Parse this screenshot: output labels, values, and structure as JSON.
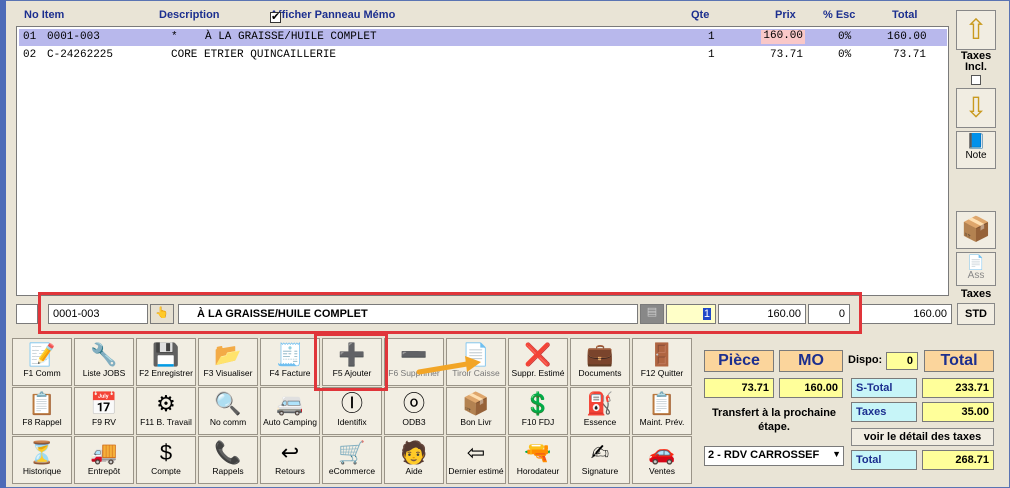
{
  "header": {
    "col_no_item": "No Item",
    "col_description": "Description",
    "memo_label": "Afficher Panneau Mémo",
    "col_qte": "Qte",
    "col_prix": "Prix",
    "col_esc": "% Esc",
    "col_total": "Total"
  },
  "rows": [
    {
      "no": "01",
      "item": "0001-003",
      "flag": "*",
      "desc": "À LA GRAISSE/HUILE COMPLET",
      "qte": "1",
      "prix": "160.00",
      "esc": "0%",
      "total": "160.00"
    },
    {
      "no": "02",
      "item": "C-24262225",
      "flag": "",
      "desc": "CORE ETRIER QUINCAILLERIE",
      "qte": "1",
      "prix": "73.71",
      "esc": "0%",
      "total": "73.71"
    }
  ],
  "right": {
    "taxes_incl": "Taxes Incl.",
    "note": "Note",
    "ass": "Ass",
    "taxes": "Taxes",
    "std": "STD"
  },
  "edit": {
    "item": "0001-003",
    "desc": "À LA GRAISSE/HUILE COMPLET",
    "qte": "1",
    "prix": "160.00",
    "esc": "0",
    "total": "160.00"
  },
  "toolbar": [
    {
      "label": "F1 Comm",
      "icon": "📝"
    },
    {
      "label": "Liste JOBS",
      "icon": "🔧"
    },
    {
      "label": "F2 Enregistrer",
      "icon": "💾"
    },
    {
      "label": "F3 Visualiser",
      "icon": "📂"
    },
    {
      "label": "F4 Facture",
      "icon": "🧾"
    },
    {
      "label": "F5 Ajouter",
      "icon": "➕"
    },
    {
      "label": "F6 Supprimer",
      "icon": "➖"
    },
    {
      "label": "Tiroir Caisse",
      "icon": "📄"
    },
    {
      "label": "Suppr. Estimé",
      "icon": "❌"
    },
    {
      "label": "Documents",
      "icon": "💼"
    },
    {
      "label": "F12 Quitter",
      "icon": "🚪"
    },
    {
      "label": "F8 Rappel",
      "icon": "📋"
    },
    {
      "label": "F9 RV",
      "icon": "📅"
    },
    {
      "label": "F11 B. Travail",
      "icon": "⚙"
    },
    {
      "label": "No comm",
      "icon": "🔍"
    },
    {
      "label": "Auto Camping",
      "icon": "🚐"
    },
    {
      "label": "Identifix",
      "icon": "Ⓘ"
    },
    {
      "label": "ODB3",
      "icon": "ⓞ"
    },
    {
      "label": "Bon Livr",
      "icon": "📦"
    },
    {
      "label": "F10 FDJ",
      "icon": "💲"
    },
    {
      "label": "Essence",
      "icon": "⛽"
    },
    {
      "label": "Maint. Prév.",
      "icon": "📋"
    },
    {
      "label": "Historique",
      "icon": "⏳"
    },
    {
      "label": "Entrepôt",
      "icon": "🚚"
    },
    {
      "label": "Compte",
      "icon": "$"
    },
    {
      "label": "Rappels",
      "icon": "📞"
    },
    {
      "label": "Retours",
      "icon": "↩"
    },
    {
      "label": "eCommerce",
      "icon": "🛒"
    },
    {
      "label": "Aide",
      "icon": "🧑"
    },
    {
      "label": "Dernier estimé",
      "icon": "⇦"
    },
    {
      "label": "Horodateur",
      "icon": "🔫"
    },
    {
      "label": "Signature",
      "icon": "✍"
    },
    {
      "label": "Ventes",
      "icon": "🚗"
    }
  ],
  "totals": {
    "piece_label": "Pièce",
    "mo_label": "MO",
    "dispo_label": "Dispo:",
    "dispo_value": "0",
    "total_label": "Total",
    "piece_value": "73.71",
    "mo_value": "160.00",
    "stotal_label": "S-Total",
    "stotal_value": "233.71",
    "transfert_label": "Transfert à la prochaine étape.",
    "taxes_label": "Taxes",
    "taxes_value": "35.00",
    "detail_button": "voir le détail des taxes",
    "step_select": "2 - RDV CARROSSEF",
    "total_row_label": "Total",
    "total_value": "268.71"
  },
  "colors": {
    "accent_red": "#e0353a",
    "selected_row": "#b8b8ec",
    "header_blue": "#1c2f8f",
    "price_highlight": "#f9c8c8"
  }
}
